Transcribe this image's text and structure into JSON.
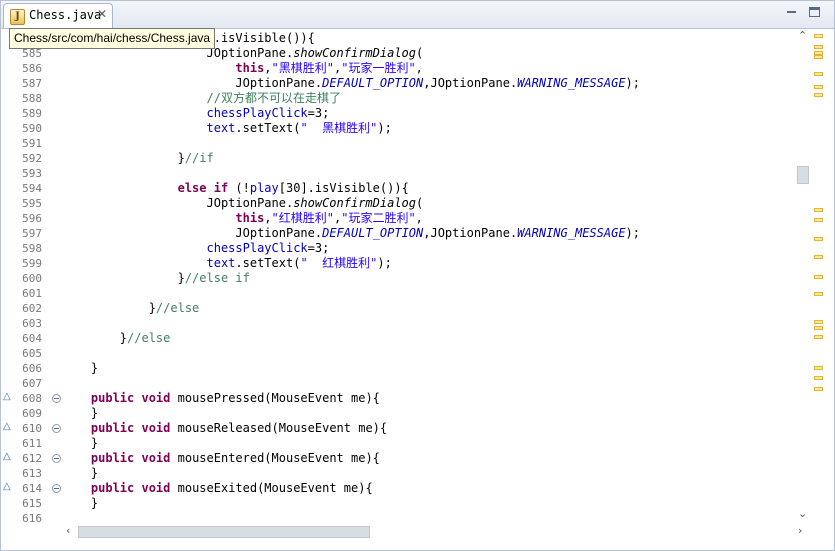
{
  "tab": {
    "title": "Chess.java",
    "close": "✕"
  },
  "tooltip": "Chess/src/com/hai/chess/Chess.java",
  "lines": [
    {
      "n": "",
      "tokens": [
        [
          "",
          "                "
        ],
        [
          "",
          "y[31].isVisible()){"
        ]
      ]
    },
    {
      "n": "585",
      "tokens": [
        [
          "",
          "                    JOptionPane."
        ],
        [
          "m",
          "showConfirmDialog"
        ],
        [
          "",
          "("
        ]
      ]
    },
    {
      "n": "586",
      "tokens": [
        [
          "",
          "                        "
        ],
        [
          "k",
          "this"
        ],
        [
          "",
          ","
        ],
        [
          "s",
          "\"黑棋胜利\""
        ],
        [
          "",
          ","
        ],
        [
          "s",
          "\"玩家一胜利\""
        ],
        [
          "",
          ","
        ]
      ]
    },
    {
      "n": "587",
      "tokens": [
        [
          "",
          "                        JOptionPane."
        ],
        [
          "sf",
          "DEFAULT_OPTION"
        ],
        [
          "",
          ",JOptionPane."
        ],
        [
          "sf",
          "WARNING_MESSAGE"
        ],
        [
          "",
          ");"
        ]
      ]
    },
    {
      "n": "588",
      "tokens": [
        [
          "",
          "                    "
        ],
        [
          "c",
          "//双方都不可以在走棋了"
        ]
      ]
    },
    {
      "n": "589",
      "tokens": [
        [
          "",
          "                    "
        ],
        [
          "f",
          "chessPlayClick"
        ],
        [
          "",
          "=3;"
        ]
      ]
    },
    {
      "n": "590",
      "tokens": [
        [
          "",
          "                    "
        ],
        [
          "f",
          "text"
        ],
        [
          "",
          ".setText("
        ],
        [
          "s",
          "\"  黑棋胜利\""
        ],
        [
          "",
          ");"
        ]
      ]
    },
    {
      "n": "591",
      "tokens": [
        [
          "",
          ""
        ]
      ]
    },
    {
      "n": "592",
      "tokens": [
        [
          "",
          "                }"
        ],
        [
          "c",
          "//if"
        ]
      ]
    },
    {
      "n": "593",
      "tokens": [
        [
          "",
          ""
        ]
      ]
    },
    {
      "n": "594",
      "tokens": [
        [
          "",
          "                "
        ],
        [
          "k",
          "else if"
        ],
        [
          "",
          " (!"
        ],
        [
          "f",
          "play"
        ],
        [
          "",
          "[30].isVisible()){"
        ]
      ]
    },
    {
      "n": "595",
      "tokens": [
        [
          "",
          "                    JOptionPane."
        ],
        [
          "m",
          "showConfirmDialog"
        ],
        [
          "",
          "("
        ]
      ]
    },
    {
      "n": "596",
      "tokens": [
        [
          "",
          "                        "
        ],
        [
          "k",
          "this"
        ],
        [
          "",
          ","
        ],
        [
          "s",
          "\"红棋胜利\""
        ],
        [
          "",
          ","
        ],
        [
          "s",
          "\"玩家二胜利\""
        ],
        [
          "",
          ","
        ]
      ]
    },
    {
      "n": "597",
      "tokens": [
        [
          "",
          "                        JOptionPane."
        ],
        [
          "sf",
          "DEFAULT_OPTION"
        ],
        [
          "",
          ",JOptionPane."
        ],
        [
          "sf",
          "WARNING_MESSAGE"
        ],
        [
          "",
          ");"
        ]
      ]
    },
    {
      "n": "598",
      "tokens": [
        [
          "",
          "                    "
        ],
        [
          "f",
          "chessPlayClick"
        ],
        [
          "",
          "=3;"
        ]
      ]
    },
    {
      "n": "599",
      "tokens": [
        [
          "",
          "                    "
        ],
        [
          "f",
          "text"
        ],
        [
          "",
          ".setText("
        ],
        [
          "s",
          "\"  红棋胜利\""
        ],
        [
          "",
          ");"
        ]
      ]
    },
    {
      "n": "600",
      "tokens": [
        [
          "",
          "                }"
        ],
        [
          "c",
          "//else if"
        ]
      ]
    },
    {
      "n": "601",
      "tokens": [
        [
          "",
          ""
        ]
      ]
    },
    {
      "n": "602",
      "tokens": [
        [
          "",
          "            }"
        ],
        [
          "c",
          "//else"
        ]
      ]
    },
    {
      "n": "603",
      "tokens": [
        [
          "",
          ""
        ]
      ]
    },
    {
      "n": "604",
      "tokens": [
        [
          "",
          "        }"
        ],
        [
          "c",
          "//else"
        ]
      ]
    },
    {
      "n": "605",
      "tokens": [
        [
          "",
          ""
        ]
      ]
    },
    {
      "n": "606",
      "tokens": [
        [
          "",
          "    }"
        ]
      ]
    },
    {
      "n": "607",
      "tokens": [
        [
          "",
          ""
        ]
      ]
    },
    {
      "n": "608",
      "ov": true,
      "tokens": [
        [
          "",
          "    "
        ],
        [
          "k",
          "public void"
        ],
        [
          "",
          " mousePressed(MouseEvent me){"
        ]
      ]
    },
    {
      "n": "609",
      "tokens": [
        [
          "",
          "    }"
        ]
      ]
    },
    {
      "n": "610",
      "ov": true,
      "tokens": [
        [
          "",
          "    "
        ],
        [
          "k",
          "public void"
        ],
        [
          "",
          " mouseReleased(MouseEvent me){"
        ]
      ]
    },
    {
      "n": "611",
      "tokens": [
        [
          "",
          "    }"
        ]
      ]
    },
    {
      "n": "612",
      "ov": true,
      "tokens": [
        [
          "",
          "    "
        ],
        [
          "k",
          "public void"
        ],
        [
          "",
          " mouseEntered(MouseEvent me){"
        ]
      ]
    },
    {
      "n": "613",
      "tokens": [
        [
          "",
          "    }"
        ]
      ]
    },
    {
      "n": "614",
      "ov": true,
      "tokens": [
        [
          "",
          "    "
        ],
        [
          "k",
          "public void"
        ],
        [
          "",
          " mouseExited(MouseEvent me){"
        ]
      ]
    },
    {
      "n": "615",
      "tokens": [
        [
          "",
          "    }"
        ]
      ]
    },
    {
      "n": "616",
      "tokens": [
        [
          "",
          ""
        ]
      ]
    }
  ],
  "colors": {
    "keyword": "#7f0055",
    "comment": "#3f7f5f",
    "string": "#2a00ff",
    "field": "#0000c0",
    "line_number": "#787878"
  }
}
